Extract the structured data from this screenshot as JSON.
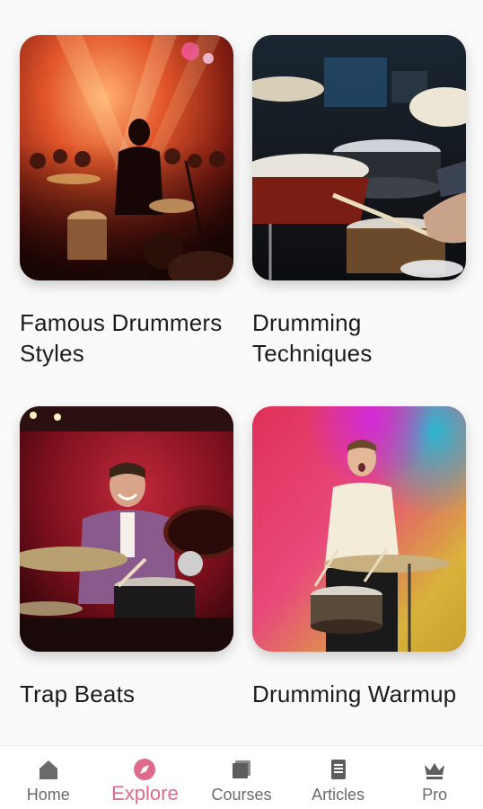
{
  "cards": [
    {
      "title": "Famous Drummers Styles"
    },
    {
      "title": "Drumming Techniques"
    },
    {
      "title": "Trap Beats"
    },
    {
      "title": "Drumming Warmup"
    }
  ],
  "bottom_nav": {
    "items": [
      {
        "label": "Home",
        "icon": "home-icon",
        "active": false
      },
      {
        "label": "Explore",
        "icon": "compass-icon",
        "active": true
      },
      {
        "label": "Courses",
        "icon": "courses-stack-icon",
        "active": false
      },
      {
        "label": "Articles",
        "icon": "article-icon",
        "active": false
      },
      {
        "label": "Pro",
        "icon": "crown-icon",
        "active": false
      }
    ]
  },
  "colors": {
    "accent": "#e06a8c",
    "inactive": "#6a6a6a",
    "background": "#fafafa"
  }
}
